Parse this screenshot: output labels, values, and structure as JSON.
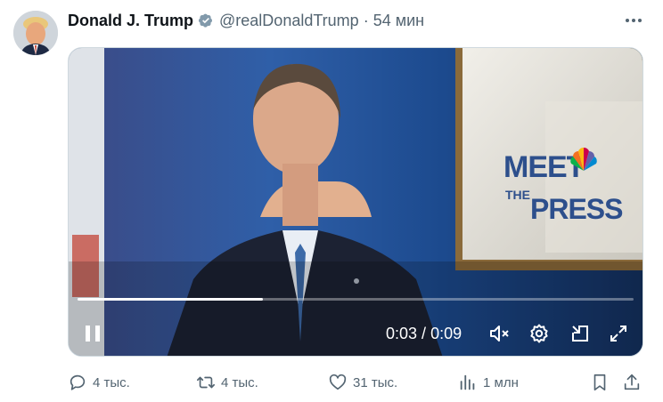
{
  "tweet": {
    "author_name": "Donald J. Trump",
    "handle": "@realDonaldTrump",
    "separator": "·",
    "time": "54 мин"
  },
  "video": {
    "backdrop_text": {
      "line1": "MEET",
      "line2": "THE",
      "line3": "PRESS"
    },
    "current_time": "0:03",
    "duration": "0:09",
    "time_separator": " / ",
    "progress_fraction": 0.333
  },
  "actions": {
    "replies": "4 тыс.",
    "retweets": "4 тыс.",
    "likes": "31 тыс.",
    "views": "1 млн"
  },
  "colors": {
    "verified_badge": "#829aab",
    "secondary_text": "#536471"
  },
  "icons": {
    "verified": "verified-badge-icon",
    "more": "more-icon",
    "pause": "pause-icon",
    "mute": "volume-muted-icon",
    "settings": "gear-icon",
    "pip": "picture-in-picture-icon",
    "fullscreen": "fullscreen-icon",
    "reply": "reply-icon",
    "retweet": "retweet-icon",
    "like": "heart-icon",
    "views": "views-icon",
    "bookmark": "bookmark-icon",
    "share": "share-icon"
  }
}
